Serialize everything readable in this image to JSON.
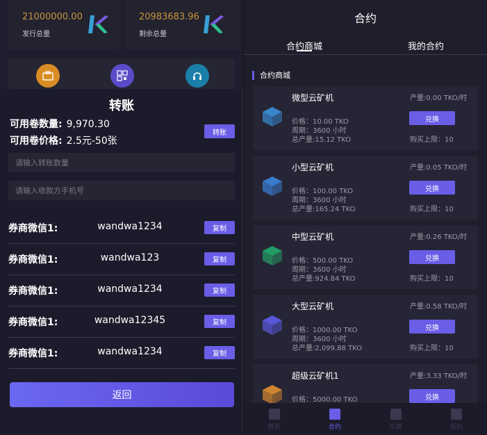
{
  "left": {
    "stats": [
      {
        "value": "21000000.00",
        "label": "发行总量"
      },
      {
        "value": "20983683.96",
        "label": "剩余总量"
      }
    ],
    "dialog": {
      "title": "转账",
      "available_label": "可用卷数量:",
      "available_value": "9,970.30",
      "price_label": "可用卷价格:",
      "price_value": "2.5元-50张",
      "transfer_button": "转账",
      "amount_placeholder": "请输入转账数量",
      "phone_placeholder": "请输入收款方手机号",
      "wechat_rows": [
        {
          "label": "券商微信1:",
          "value": "wandwa1234",
          "button": "复制"
        },
        {
          "label": "券商微信1:",
          "value": "wandwa123",
          "button": "复制"
        },
        {
          "label": "券商微信1:",
          "value": "wandwa1234",
          "button": "复制"
        },
        {
          "label": "券商微信1:",
          "value": "wandwa12345",
          "button": "复制"
        },
        {
          "label": "券商微信1:",
          "value": "wandwa1234",
          "button": "复制"
        }
      ],
      "back_button": "返回"
    }
  },
  "right": {
    "title": "合约",
    "tabs": [
      "合约商城",
      "我的合约"
    ],
    "section": "合约商城",
    "cards": [
      {
        "name": "微型云矿机",
        "price": "价格：10.00 TKO",
        "cycle": "周期：3600 小时",
        "total": "总产量:15.12 TKO",
        "production": "产量:0.00 TKO/时",
        "button": "兑换",
        "limit": "购买上限：10",
        "color": "#3a8bd6"
      },
      {
        "name": "小型云矿机",
        "price": "价格：100.00 TKO",
        "cycle": "周期：3600 小时",
        "total": "总产量:165.24 TKO",
        "production": "产量:0.05 TKO/时",
        "button": "兑换",
        "limit": "购买上限：10",
        "color": "#3a7fd6"
      },
      {
        "name": "中型云矿机",
        "price": "价格：500.00 TKO",
        "cycle": "周期：3600 小时",
        "total": "总产量:924.84 TKO",
        "production": "产量:0.26 TKO/时",
        "button": "兑换",
        "limit": "购买上限：10",
        "color": "#23a36a"
      },
      {
        "name": "大型云矿机",
        "price": "价格：1000.00 TKO",
        "cycle": "周期：3600 小时",
        "total": "总产量:2,099.88 TKO",
        "production": "产量:0.58 TKO/时",
        "button": "兑换",
        "limit": "购买上限：10",
        "color": "#5a5ae0"
      },
      {
        "name": "超级云矿机1",
        "price": "价格：5000.00 TKO",
        "cycle": "",
        "total": "",
        "production": "产量:3.33 TKO/时",
        "button": "兑换",
        "limit": "",
        "color": "#d9892f"
      }
    ],
    "nav": [
      {
        "label": "首页",
        "icon": "home-icon",
        "active": false
      },
      {
        "label": "合约",
        "icon": "contract-icon",
        "active": true
      },
      {
        "label": "交易",
        "icon": "trade-icon",
        "active": false
      },
      {
        "label": "我的",
        "icon": "user-icon",
        "active": false
      }
    ]
  }
}
